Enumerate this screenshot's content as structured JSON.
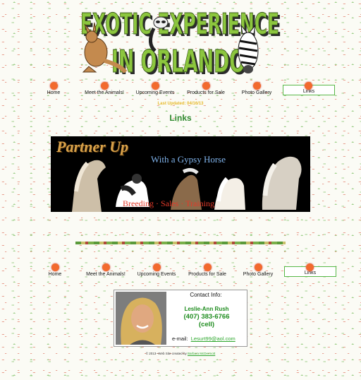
{
  "site": {
    "logo_text_line1": "EXOTIC EXPERIENCE",
    "logo_text_line2": "IN ORLANDO"
  },
  "nav": {
    "items": [
      {
        "label": "Home"
      },
      {
        "label": "Meet the Animals!"
      },
      {
        "label": "Upcoming Events"
      },
      {
        "label": "Products for Sale"
      },
      {
        "label": "Photo Gallery"
      },
      {
        "label": "Links"
      }
    ],
    "active": "Links"
  },
  "page": {
    "last_updated": "Last Updated:  04/16/13",
    "title": "Links"
  },
  "banner": {
    "title": "Partner Up",
    "subtitle": "With a Gypsy Horse",
    "tagline": "Breeding  ·  Sales  ·  Training"
  },
  "contact": {
    "title": "Contact Info:",
    "name": "Leslie-Ann Rush",
    "phone": "(407) 383-6766",
    "phone_note": "(cell)",
    "email_label": "e-mail:",
    "email": "Lesurt99@aol.com"
  },
  "footer": {
    "text": "© 2013--Web Site created by",
    "author": "Barbara McDermott"
  },
  "colors": {
    "nav_dot": "#f26a2e",
    "active_border": "#58b848",
    "title_green": "#2f8a2f",
    "updated_gold": "#e6b92b",
    "link_green": "#2fa82f"
  }
}
